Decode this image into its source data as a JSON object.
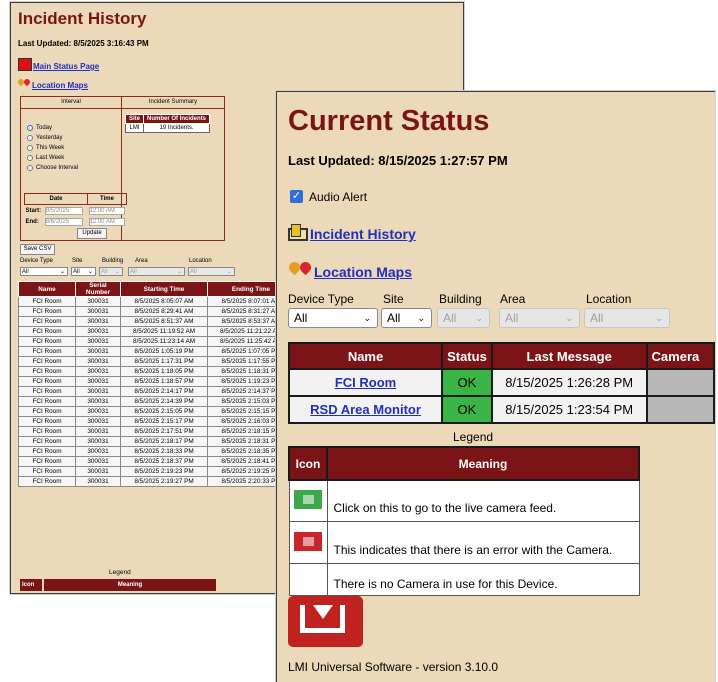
{
  "back": {
    "title": "Incident History",
    "last_updated": "Last Updated: 8/5/2025 3:16:43 PM",
    "main_status_link": "Main Status Page",
    "location_maps_link": "Location Maps",
    "interval_header": "Interval",
    "summary_header": "Incident Summary",
    "summary_col_site": "Site",
    "summary_col_count": "Number Of Incidents",
    "summary_site": "LMI",
    "summary_count": "19 Incidents.",
    "intervals": [
      "Today",
      "Yesterday",
      "This Week",
      "Last Week",
      "Choose Interval"
    ],
    "date_header": "Date",
    "time_header": "Time",
    "start_label": "Start:",
    "start_date": "8/5/2025",
    "start_time": "12:00 AM",
    "end_label": "End:",
    "end_date": "8/6/2025",
    "end_time": "12:00 AM",
    "update_button": "Update",
    "save_csv": "Save CSV",
    "filter_labels": {
      "device_type": "Device Type",
      "site": "Site",
      "building": "Building",
      "area": "Area",
      "location": "Location"
    },
    "filter_values": {
      "device_type": "All",
      "site": "All",
      "building": "All",
      "area": "All",
      "location": "All"
    },
    "columns": [
      "Name",
      "Serial Number",
      "Starting Time",
      "Ending Time"
    ],
    "rows": [
      [
        "FCI Room",
        "300031",
        "8/5/2025 8:05:07 AM",
        "8/5/2025 8:07:01 AM"
      ],
      [
        "FCI Room",
        "300031",
        "8/5/2025 8:29:41 AM",
        "8/5/2025 8:31:27 AM"
      ],
      [
        "FCI Room",
        "300031",
        "8/5/2025 8:51:37 AM",
        "8/5/2025 8:53:37 AM"
      ],
      [
        "FCI Room",
        "300031",
        "8/5/2025 11:19:52 AM",
        "8/5/2025 11:21:22 AM"
      ],
      [
        "FCI Room",
        "300031",
        "8/5/2025 11:23:14 AM",
        "8/5/2025 11:25:42 AM"
      ],
      [
        "FCI Room",
        "300031",
        "8/5/2025 1:05:19 PM",
        "8/5/2025 1:07:05 PM"
      ],
      [
        "FCI Room",
        "300031",
        "8/5/2025 1:17:31 PM",
        "8/5/2025 1:17:55 PM"
      ],
      [
        "FCI Room",
        "300031",
        "8/5/2025 1:18:05 PM",
        "8/5/2025 1:18:31 PM"
      ],
      [
        "FCI Room",
        "300031",
        "8/5/2025 1:18:57 PM",
        "8/5/2025 1:19:23 PM"
      ],
      [
        "FCI Room",
        "300031",
        "8/5/2025 2:14:17 PM",
        "8/5/2025 2:14:37 PM"
      ],
      [
        "FCI Room",
        "300031",
        "8/5/2025 2:14:39 PM",
        "8/5/2025 2:15:03 PM"
      ],
      [
        "FCI Room",
        "300031",
        "8/5/2025 2:15:05 PM",
        "8/5/2025 2:15:15 PM"
      ],
      [
        "FCI Room",
        "300031",
        "8/5/2025 2:15:17 PM",
        "8/5/2025 2:16:03 PM"
      ],
      [
        "FCI Room",
        "300031",
        "8/5/2025 2:17:51 PM",
        "8/5/2025 2:18:15 PM"
      ],
      [
        "FCI Room",
        "300031",
        "8/5/2025 2:18:17 PM",
        "8/5/2025 2:18:31 PM"
      ],
      [
        "FCI Room",
        "300031",
        "8/5/2025 2:18:33 PM",
        "8/5/2025 2:18:35 PM"
      ],
      [
        "FCI Room",
        "300031",
        "8/5/2025 2:18:37 PM",
        "8/5/2025 2:18:41 PM"
      ],
      [
        "FCI Room",
        "300031",
        "8/5/2025 2:19:23 PM",
        "8/5/2025 2:19:25 PM"
      ],
      [
        "FCI Room",
        "300031",
        "8/5/2025 2:19:27 PM",
        "8/5/2025 2:20:33 PM"
      ]
    ],
    "legend_title": "Legend",
    "legend_icon_col": "Icon",
    "legend_meaning_col": "Meaning"
  },
  "front": {
    "title": "Current Status",
    "last_updated": "Last Updated: 8/15/2025 1:27:57 PM",
    "audio_alert": "Audio Alert",
    "incident_history_link": "Incident History",
    "location_maps_link": "Location Maps",
    "filter_labels": {
      "device_type": "Device Type",
      "site": "Site",
      "building": "Building",
      "area": "Area",
      "location": "Location"
    },
    "filter_values": {
      "device_type": "All",
      "site": "All",
      "building": "All",
      "area": "All",
      "location": "All"
    },
    "columns": [
      "Name",
      "Status",
      "Last Message",
      "Camera"
    ],
    "rows": [
      {
        "name": "FCI Room",
        "status": "OK",
        "last_message": "8/15/2025 1:26:28 PM"
      },
      {
        "name": "RSD Area Monitor",
        "status": "OK",
        "last_message": "8/15/2025 1:23:54 PM"
      }
    ],
    "legend_title": "Legend",
    "legend_icon_col": "Icon",
    "legend_meaning_col": "Meaning",
    "legend_rows": [
      {
        "icon": "camera-live-icon",
        "meaning": "Click on this to go to the live camera feed."
      },
      {
        "icon": "camera-error-icon",
        "meaning": "This indicates that there is an error with the Camera."
      },
      {
        "icon": "",
        "meaning": "There is no Camera in use for this Device."
      }
    ],
    "version": "LMI Universal Software - version 3.10.0"
  },
  "colors": {
    "background": "#ecd9b9",
    "header": "#7a1416",
    "ok": "#39b545",
    "link": "#1f2fbf"
  }
}
